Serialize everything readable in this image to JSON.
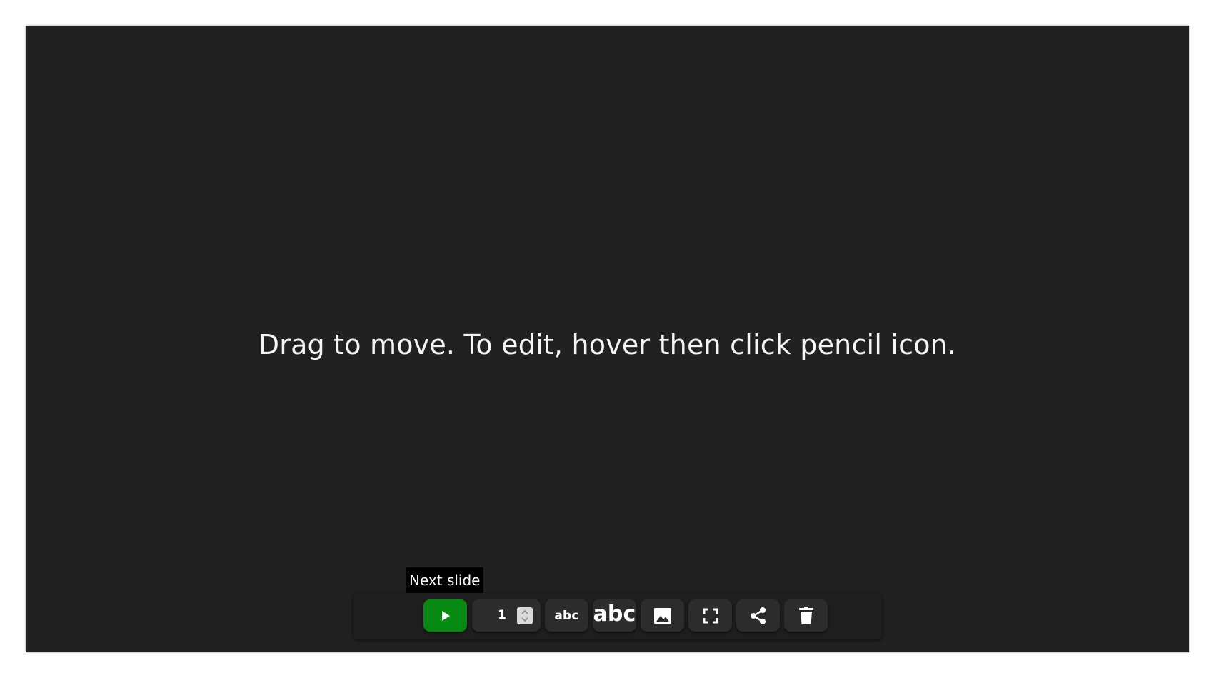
{
  "slide": {
    "text": "Drag to move. To edit, hover then click pencil icon."
  },
  "tooltip": {
    "text": "Next slide"
  },
  "toolbar": {
    "play_icon": "play-icon",
    "slide_number": "1",
    "text_small_label": "abc",
    "text_large_label": "abc",
    "image_icon": "image-icon",
    "fullscreen_icon": "fullscreen-icon",
    "share_icon": "share-icon",
    "delete_icon": "trash-icon"
  },
  "colors": {
    "slide_background": "#212121",
    "play_button": "#078a12",
    "toolbar_background": "#1e1e1e",
    "button_background": "#2c2c2c"
  }
}
